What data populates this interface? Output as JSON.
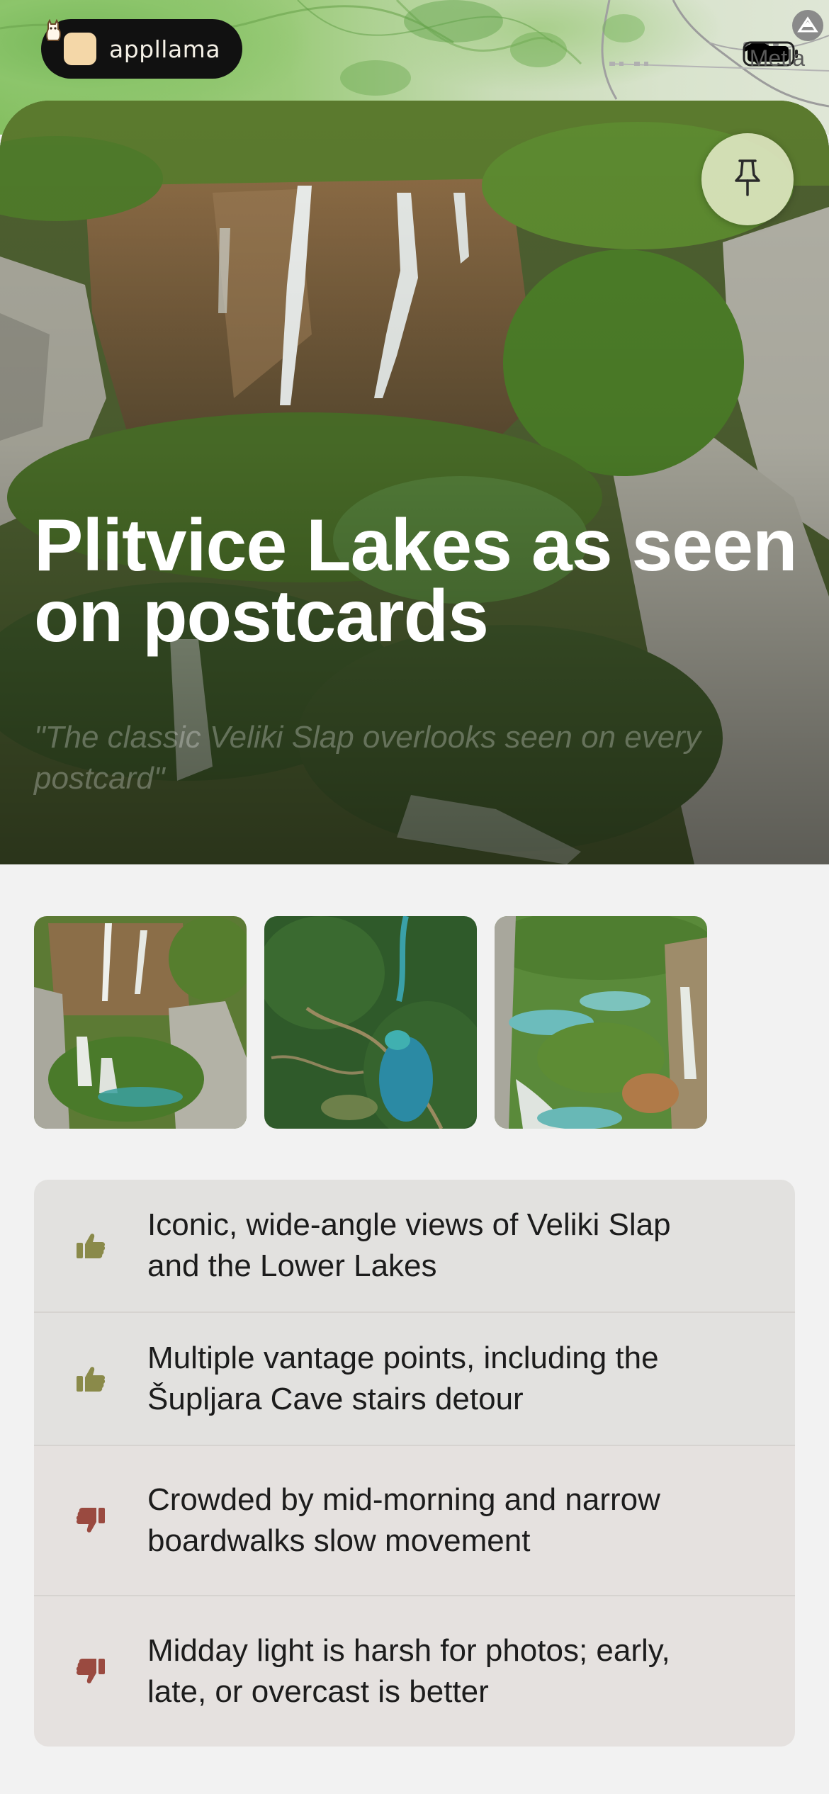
{
  "brand": {
    "name": "appllama"
  },
  "map": {
    "place_label": "Metla"
  },
  "hero": {
    "title": "Plitvice Lakes as seen on postcards",
    "quote": "\"The classic Veliki Slap overlooks seen on every postcard\"",
    "pin_icon": "pushpin-icon"
  },
  "gallery": {
    "thumbnails": [
      {
        "name": "waterfall-cliffs-photo"
      },
      {
        "name": "aerial-lake-photo"
      },
      {
        "name": "lower-lakes-photo"
      }
    ]
  },
  "points": [
    {
      "type": "pro",
      "icon": "thumbs-up-icon",
      "text": "Iconic, wide-angle views of Veliki Slap and the Lower Lakes"
    },
    {
      "type": "pro",
      "icon": "thumbs-up-icon",
      "text": "Multiple vantage points, including the Šupljara Cave stairs detour"
    },
    {
      "type": "con",
      "icon": "thumbs-down-icon",
      "text": "Crowded by mid-morning and narrow boardwalks slow movement"
    },
    {
      "type": "con",
      "icon": "thumbs-down-icon",
      "text": "Midday light is harsh for photos; early, late, or overcast is better"
    }
  ],
  "colors": {
    "pro_icon": "#8a8a4a",
    "con_icon": "#9a4a40",
    "background": "#f2f2f2"
  }
}
